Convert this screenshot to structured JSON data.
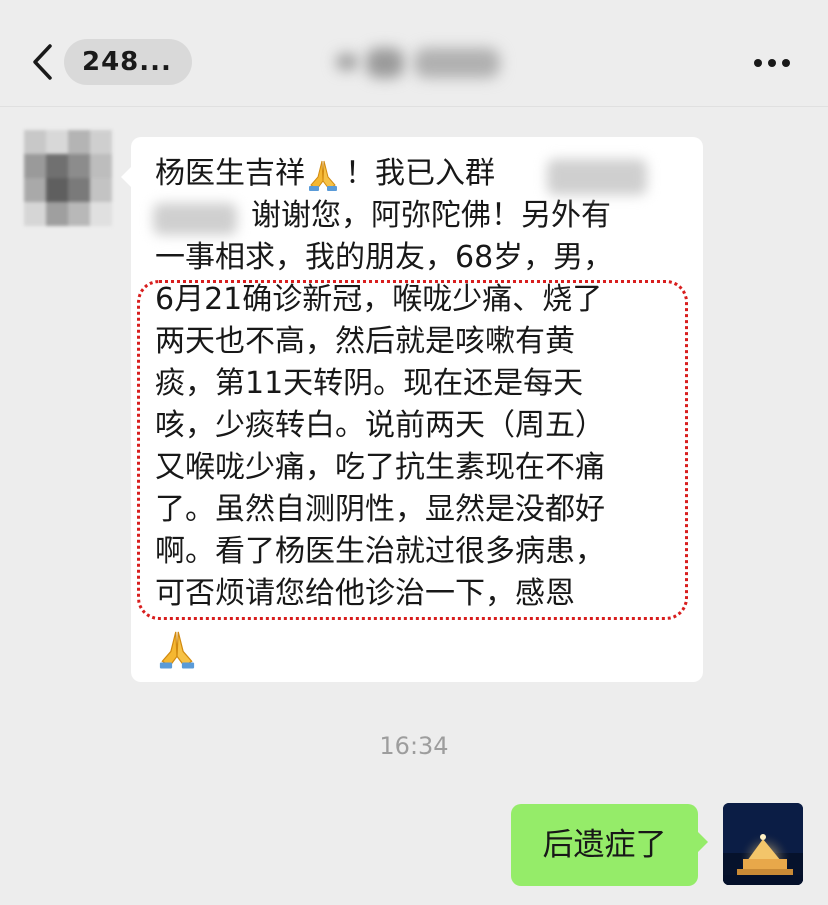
{
  "header": {
    "unread_label": "248...",
    "back_icon": "chevron-left-icon",
    "more_icon": "ellipsis-icon"
  },
  "chat": {
    "incoming": {
      "line1_a": "杨医生吉祥",
      "line1_b": "！我已入群",
      "line2": "谢谢您，阿弥陀佛！另外有",
      "line3": "一事相求，我的朋友，68岁，男，",
      "line4": "6月21确诊新冠，喉咙少痛、烧了",
      "line5": "两天也不高，然后就是咳嗽有黄",
      "line6": "痰，第11天转阴。现在还是每天",
      "line7": "咳，少痰转白。说前两天（周五）",
      "line8": "又喉咙少痛，吃了抗生素现在不痛",
      "line9": "了。虽然自测阴性，显然是没都好",
      "line10": "啊。看了杨医生治就过很多病患，",
      "line11": "可否烦请您给他诊治一下，感恩",
      "emoji": "folded-hands-icon",
      "highlight_color": "#d81e1e"
    },
    "timestamp": "16:34",
    "outgoing": {
      "text": "后遗症了",
      "bubble_color": "#95ec69"
    }
  }
}
